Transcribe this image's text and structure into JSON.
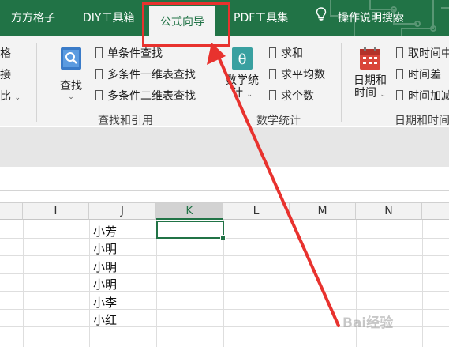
{
  "tabs": [
    {
      "label": "方方格子"
    },
    {
      "label": "DIY工具箱"
    },
    {
      "label": "公式向导",
      "active": true
    },
    {
      "label": "PDF工具集"
    },
    {
      "label": "操作说明搜索",
      "icon": "lightbulb-icon"
    }
  ],
  "ribbon": {
    "left_cut": [
      "格",
      "接",
      "比"
    ],
    "lookup": {
      "big_button": "查找",
      "items": [
        "单条件查找",
        "多条件一维表查找",
        "多条件二维表查找"
      ],
      "group_label": "查找和引用"
    },
    "math": {
      "big_button_line1": "数学统",
      "big_button_line2": "计",
      "items": [
        "求和",
        "求平均数",
        "求个数"
      ],
      "group_label": "数学统计"
    },
    "datetime": {
      "big_button_line1": "日期和",
      "big_button_line2": "时间",
      "items": [
        "取时间中",
        "时间差",
        "时间加减"
      ],
      "group_label": "日期和时间"
    }
  },
  "grid": {
    "columns": [
      "I",
      "J",
      "K",
      "L",
      "M",
      "N"
    ],
    "selected_column": "K",
    "column_j_values": [
      "小芳",
      "小明",
      "小明",
      "小明",
      "小李",
      "小红"
    ]
  },
  "watermark": "Bai经验",
  "colors": {
    "excel_green": "#217346",
    "annotation_red": "#e8322e"
  }
}
